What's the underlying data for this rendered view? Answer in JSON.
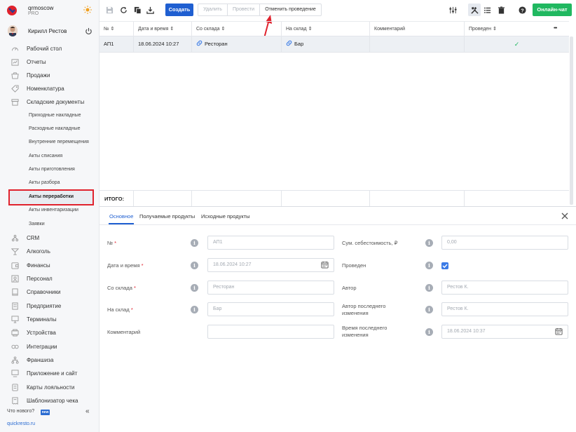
{
  "brand": {
    "name": "qrmoscow",
    "plan": "PRO"
  },
  "user": {
    "name": "Кирилл Рестов"
  },
  "nav": {
    "items": [
      {
        "label": "Рабочий стол",
        "icon": "speedometer-icon"
      },
      {
        "label": "Отчеты",
        "icon": "chart-icon"
      },
      {
        "label": "Продажи",
        "icon": "basket-icon"
      },
      {
        "label": "Номенклатура",
        "icon": "tag-icon"
      },
      {
        "label": "Складские документы",
        "icon": "box-icon"
      }
    ],
    "subitems": [
      {
        "label": "Приходные накладные"
      },
      {
        "label": "Расходные накладные"
      },
      {
        "label": "Внутренние перемещения"
      },
      {
        "label": "Акты списания"
      },
      {
        "label": "Акты приготовления"
      },
      {
        "label": "Акты разбора"
      },
      {
        "label": "Акты переработки",
        "active": true
      },
      {
        "label": "Акты инвентаризации"
      },
      {
        "label": "Заявки"
      }
    ],
    "items2": [
      {
        "label": "CRM",
        "icon": "users-icon"
      },
      {
        "label": "Алкоголь",
        "icon": "glass-icon"
      },
      {
        "label": "Финансы",
        "icon": "wallet-icon"
      },
      {
        "label": "Персонал",
        "icon": "person-icon"
      },
      {
        "label": "Справочники",
        "icon": "book-icon"
      },
      {
        "label": "Предприятие",
        "icon": "building-icon"
      },
      {
        "label": "Терминалы",
        "icon": "terminal-icon"
      },
      {
        "label": "Устройства",
        "icon": "device-icon"
      },
      {
        "label": "Интеграции",
        "icon": "link-icon"
      },
      {
        "label": "Франшиза",
        "icon": "network-icon"
      },
      {
        "label": "Приложение и сайт",
        "icon": "monitor-icon"
      },
      {
        "label": "Карты лояльности",
        "icon": "card-icon"
      },
      {
        "label": "Шаблонизатор чека",
        "icon": "receipt-icon"
      }
    ],
    "whats_new": "Что нового?",
    "new_badge": "new",
    "collapse": "«",
    "site": "quickresto.ru"
  },
  "toolbar": {
    "create": "Создать",
    "delete": "Удалить",
    "post": "Провести",
    "unpost": "Отменить проведение",
    "chat": "Онлайн-чат"
  },
  "table": {
    "columns": [
      "№",
      "Дата и время",
      "Со склада",
      "На склад",
      "Комментарий",
      "Проведен"
    ],
    "sort_glyph": "⇕",
    "more": "•••",
    "rows": [
      {
        "num": "АП1",
        "datetime": "18.06.2024 10:27",
        "from": "Ресторан",
        "to": "Бар",
        "comment": "",
        "posted": "✓"
      }
    ],
    "total_label": "ИТОГО:"
  },
  "form": {
    "tabs": [
      "Основное",
      "Получаемые продукты",
      "Исходные продукты"
    ],
    "info_glyph": "i",
    "left": [
      {
        "label": "№",
        "required": true,
        "value": "АП1"
      },
      {
        "label": "Дата и время",
        "required": true,
        "value": "18.06.2024 10:27"
      },
      {
        "label": "Со склада",
        "required": true,
        "value": "Ресторан"
      },
      {
        "label": "На склад",
        "required": true,
        "value": "Бар"
      },
      {
        "label": "Комментарий",
        "required": false,
        "value": ""
      }
    ],
    "right": [
      {
        "label": "Сум. себестоимость, ₽",
        "value": "0,00"
      },
      {
        "label": "Проведен",
        "value": "checked"
      },
      {
        "label": "Автор",
        "value": "Рестов К."
      },
      {
        "label": "Автор последнего изменения",
        "value": "Рестов К."
      },
      {
        "label": "Время последнего изменения",
        "value": "18.06.2024 10:37"
      }
    ],
    "required_mark": "*"
  },
  "colors": {
    "accent": "#1f5fd1",
    "chat": "#20b860",
    "highlight": "#e0222d"
  }
}
